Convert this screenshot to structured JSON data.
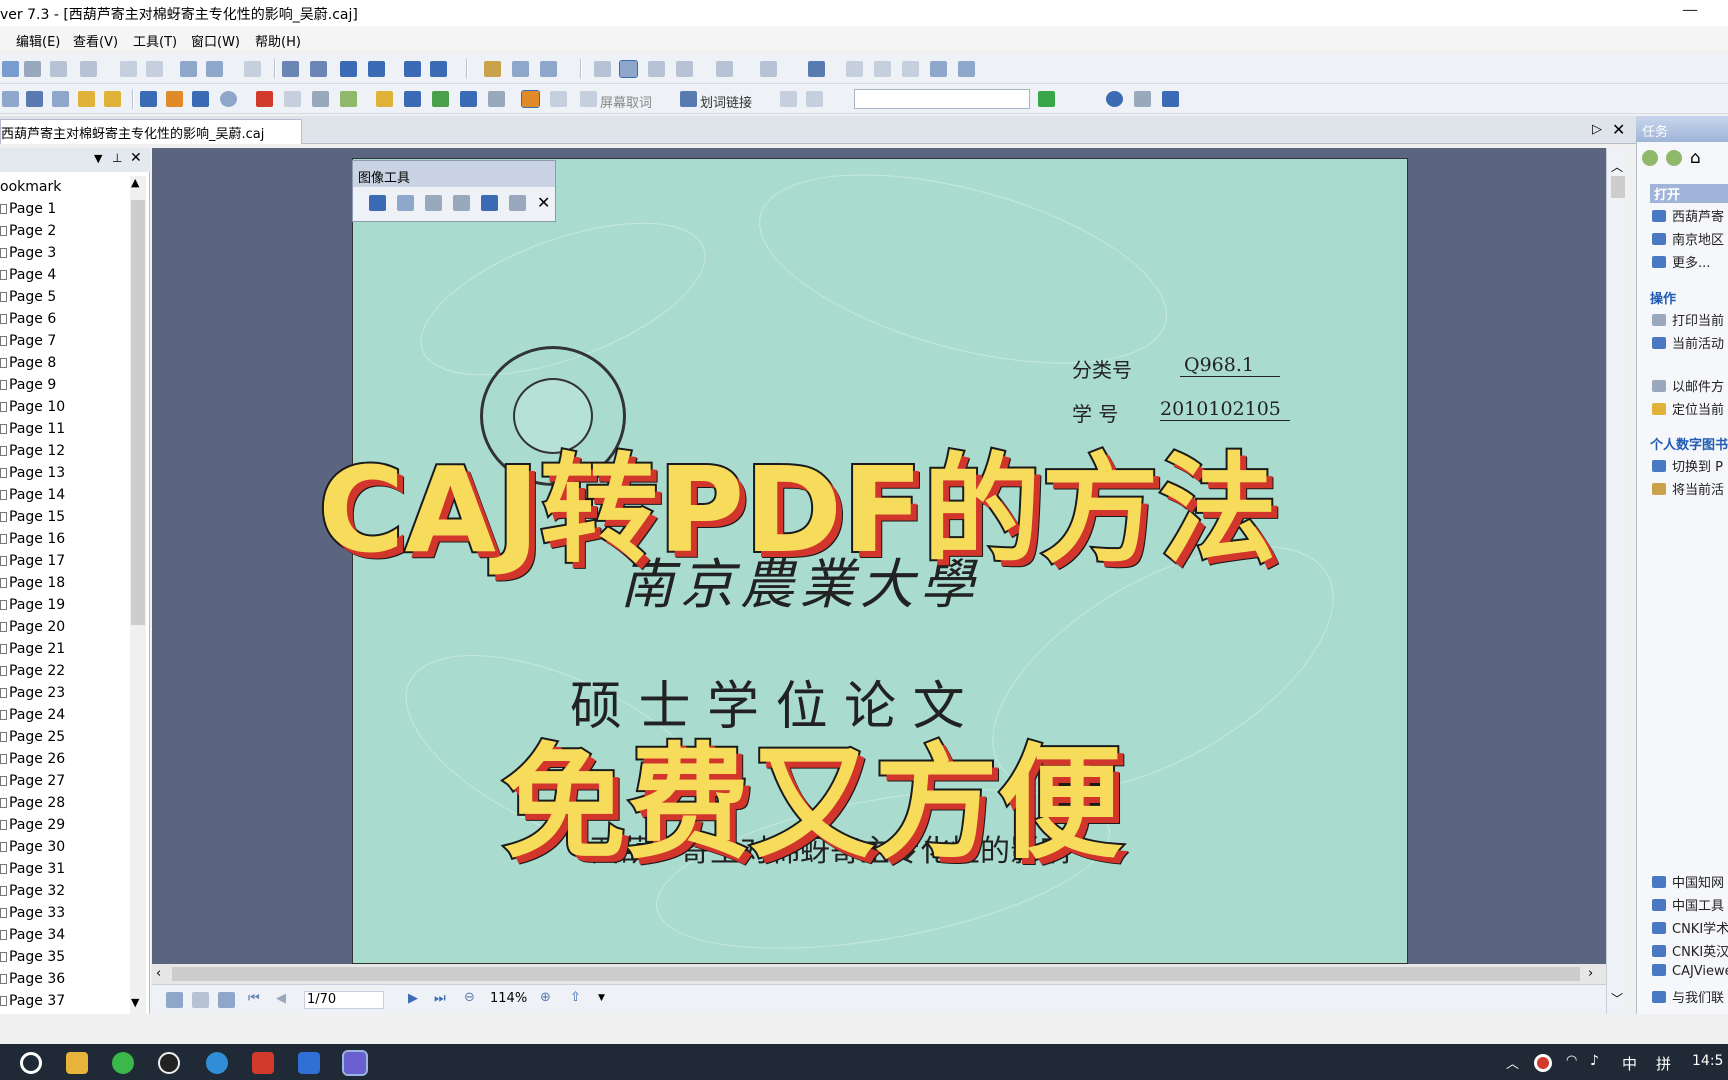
{
  "window": {
    "title": "ver 7.3 - [西葫芦寄主对棉蚜寄主专化性的影响_吴蔚.caj]",
    "minimize": "—"
  },
  "menu": {
    "items": [
      "编辑(E)",
      "查看(V)",
      "工具(T)",
      "窗口(W)",
      "帮助(H)"
    ]
  },
  "toolbar": {
    "screen_ocr_label": "屏幕取词",
    "word_link_label": "划词链接"
  },
  "tab": {
    "document_title": "西葫芦寄主对棉蚜寄主专化性的影响_吴蔚.caj"
  },
  "bookmark": {
    "header": "ookmark",
    "pages": [
      "Page 1",
      "Page 2",
      "Page 3",
      "Page 4",
      "Page 5",
      "Page 6",
      "Page 7",
      "Page 8",
      "Page 9",
      "Page 10",
      "Page 11",
      "Page 12",
      "Page 13",
      "Page 14",
      "Page 15",
      "Page 16",
      "Page 17",
      "Page 18",
      "Page 19",
      "Page 20",
      "Page 21",
      "Page 22",
      "Page 23",
      "Page 24",
      "Page 25",
      "Page 26",
      "Page 27",
      "Page 28",
      "Page 29",
      "Page 30",
      "Page 31",
      "Page 32",
      "Page 33",
      "Page 34",
      "Page 35",
      "Page 36",
      "Page 37"
    ]
  },
  "image_tools": {
    "title": "图像工具",
    "close": "✕"
  },
  "page_content": {
    "class_label": "分类号",
    "class_value": "Q968.1",
    "student_label": "学  号",
    "student_value": "2010102105",
    "university": "南京農業大學",
    "degree": "硕 士 学 位 论 文",
    "thesis_title": "西葫芦寄主对棉蚜寄主专化性的影响"
  },
  "overlay": {
    "line1": "CAJ转PDF的方法",
    "line2": "免费又方便",
    "color_fill": "#f7dc5c",
    "color_shadow": "#d1352b"
  },
  "status": {
    "page_indicator": "1/70",
    "zoom": "114%"
  },
  "task_pane": {
    "title": "任务",
    "open_section": "打开",
    "open_items": [
      "西葫芦寄",
      "南京地区",
      "更多..."
    ],
    "ops_section": "操作",
    "ops_items": [
      "打印当前",
      "当前活动",
      "以邮件方",
      "定位当前"
    ],
    "personal_section": "个人数字图书",
    "personal_items": [
      "切换到 P",
      "将当前活"
    ],
    "links": [
      "中国知网",
      "中国工具",
      "CNKI学术",
      "CNKI英汉",
      "CAJViewe",
      "与我们联"
    ]
  },
  "taskbar": {
    "ime": "中",
    "ime2": "拼",
    "clock": "14:5"
  }
}
